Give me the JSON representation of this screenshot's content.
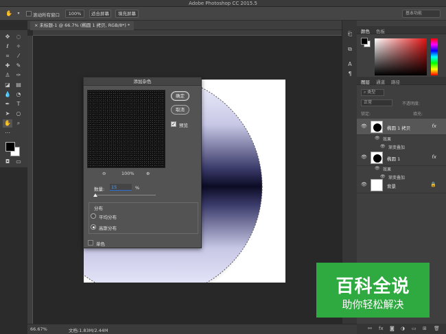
{
  "app": {
    "title": "Adobe Photoshop CC 2015.5"
  },
  "options_bar": {
    "hand_icon": "hand-icon",
    "scroll_all_windows_label": "滚动所有窗口",
    "zoom_100": "100%",
    "fit_screen": "适合屏幕",
    "fill_screen": "填充屏幕",
    "workspace": "基本功能"
  },
  "document": {
    "tab_label": "未标题-1 @ 66.7% (椭圆 1 拷贝, RGB/8*) *",
    "zoom": "66.67%",
    "doc_size": "文档:1.83M/2.44M"
  },
  "dialog": {
    "title": "添加杂色",
    "ok_label": "确定",
    "cancel_label": "取消",
    "preview_label": "预览",
    "preview_zoom": "100%",
    "amount_label": "数量:",
    "amount_value": "15",
    "amount_unit": "%",
    "amount_percent": 15,
    "distribution_label": "分布",
    "uniform_label": "平均分布",
    "gaussian_label": "高斯分布",
    "monochromatic_label": "单色",
    "preview_checked": true,
    "selected_distribution": "gaussian",
    "monochromatic_checked": false
  },
  "color_panel": {
    "tab_color": "颜色",
    "tab_swatches": "色板",
    "foreground": "#000000",
    "background": "#ffffff",
    "hue": "#e11212"
  },
  "layers_panel": {
    "tab_layers": "图层",
    "tab_channels": "通道",
    "tab_paths": "路径",
    "filter_kind": "类型",
    "blend_mode": "正常",
    "opacity_label": "不透明度:",
    "lock_label": "锁定:",
    "fill_label": "填充:",
    "layers": [
      {
        "name": "椭圆 1 拷贝",
        "fx": "fx"
      },
      {
        "name": "椭圆 1",
        "fx": "fx"
      },
      {
        "name": "背景"
      }
    ],
    "effects_label": "效果",
    "gradient_overlay_label": "渐变叠加"
  },
  "watermark": {
    "title": "百科全说",
    "subtitle": "助你轻松解决",
    "color": "#2faa40"
  }
}
